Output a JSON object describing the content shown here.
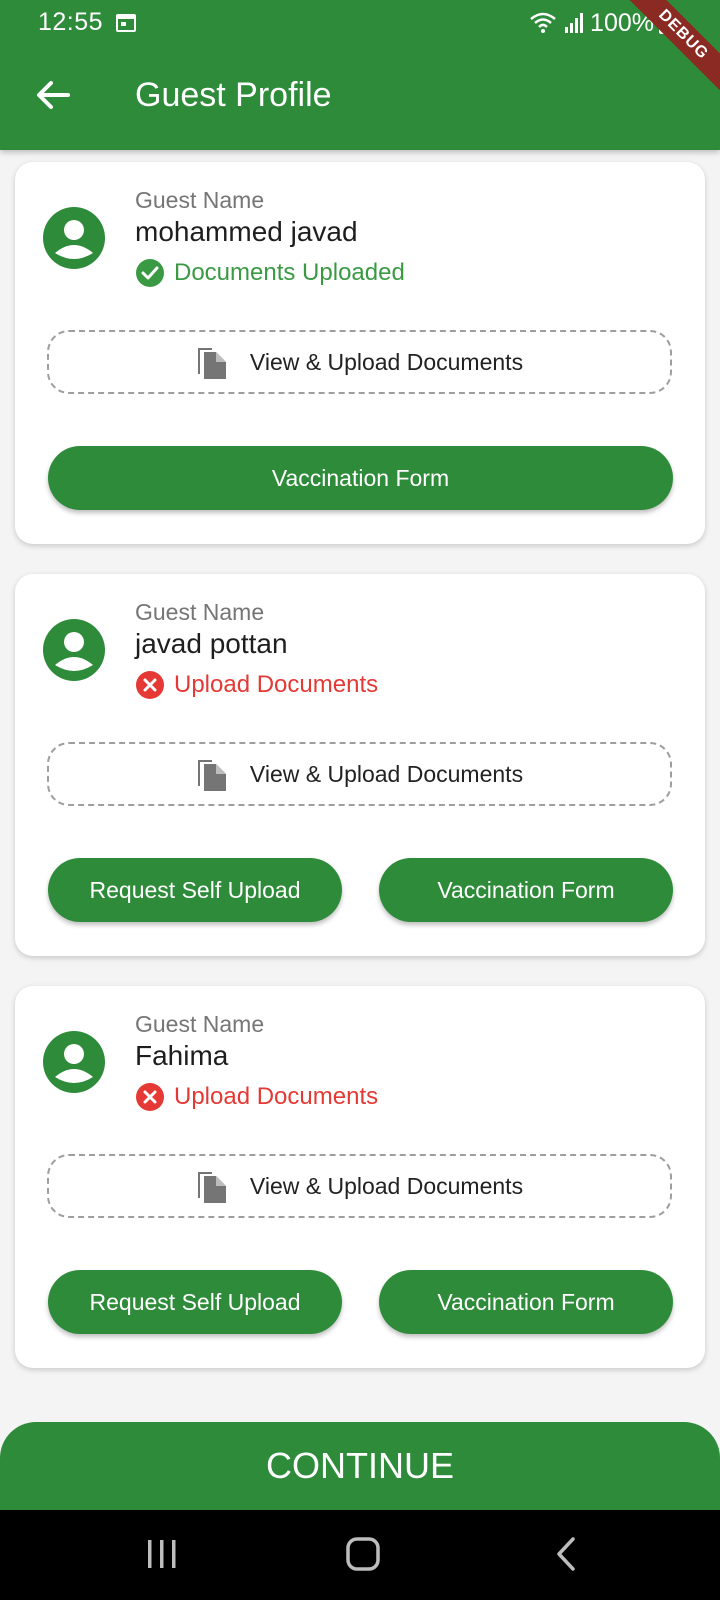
{
  "status_bar": {
    "time": "12:55",
    "battery": "100%",
    "icons": [
      "calendar-icon",
      "wifi-icon",
      "signal-icon",
      "battery-icon"
    ]
  },
  "app_bar": {
    "title": "Guest Profile",
    "back_icon": "arrow-left-icon",
    "debug_banner": "DEBUG"
  },
  "colors": {
    "primary": "#2e8b3a",
    "success": "#3a9a44",
    "error": "#e53935",
    "background": "#f4f4f4"
  },
  "guests": [
    {
      "label": "Guest Name",
      "name": "mohammed javad",
      "status": "Documents Uploaded",
      "status_type": "success",
      "upload_label": "View & Upload Documents",
      "vaccination_label": "Vaccination Form"
    },
    {
      "label": "Guest Name",
      "name": "javad pottan",
      "status": "Upload Documents",
      "status_type": "error",
      "upload_label": "View & Upload Documents",
      "request_label": "Request Self Upload",
      "vaccination_label": "Vaccination Form"
    },
    {
      "label": "Guest Name",
      "name": "Fahima",
      "status": "Upload Documents",
      "status_type": "error",
      "upload_label": "View & Upload Documents",
      "request_label": "Request Self Upload",
      "vaccination_label": "Vaccination Form"
    }
  ],
  "continue_label": "CONTINUE",
  "nav_bar": {
    "items": [
      "recent-apps-icon",
      "home-icon",
      "back-icon"
    ]
  }
}
